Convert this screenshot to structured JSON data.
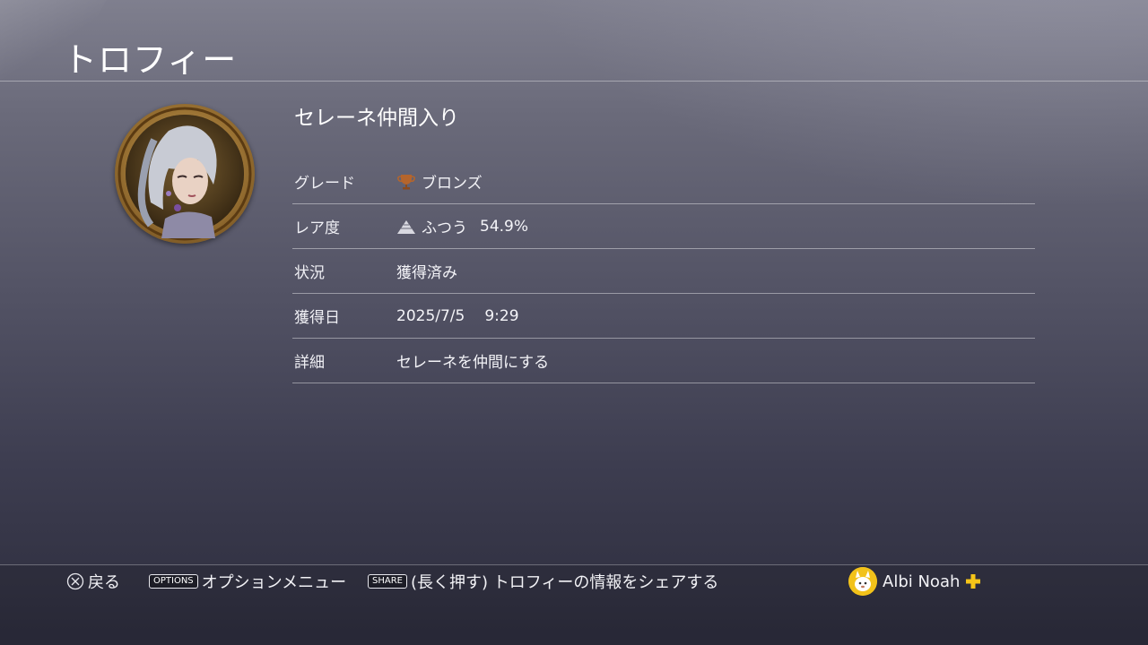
{
  "header": {
    "title": "トロフィー"
  },
  "trophy": {
    "name": "セレーネ仲間入り",
    "image_icon": "character-portrait-icon"
  },
  "details": {
    "grade": {
      "label": "グレード",
      "value": "ブロンズ",
      "icon": "bronze-trophy-icon"
    },
    "rarity": {
      "label": "レア度",
      "value": "ふつう",
      "percent": "54.9%",
      "icon": "rarity-pyramid-icon"
    },
    "status": {
      "label": "状況",
      "value": "獲得済み"
    },
    "earned": {
      "label": "獲得日",
      "date": "2025/7/5",
      "time": "9:29"
    },
    "detail": {
      "label": "詳細",
      "value": "セレーネを仲間にする"
    }
  },
  "footer": {
    "back": {
      "button": "cross-button-icon",
      "label": "戻る"
    },
    "options": {
      "key": "OPTIONS",
      "label": "オプションメニュー"
    },
    "share": {
      "key": "SHARE",
      "label": "(長く押す) トロフィーの情報をシェアする"
    },
    "user": {
      "name": "Albi Noah",
      "plus_icon": "ps-plus-icon"
    }
  },
  "colors": {
    "bronze": "#b5652c",
    "plus_gold": "#f5c518",
    "avatar_bg": "#f2c21a"
  }
}
